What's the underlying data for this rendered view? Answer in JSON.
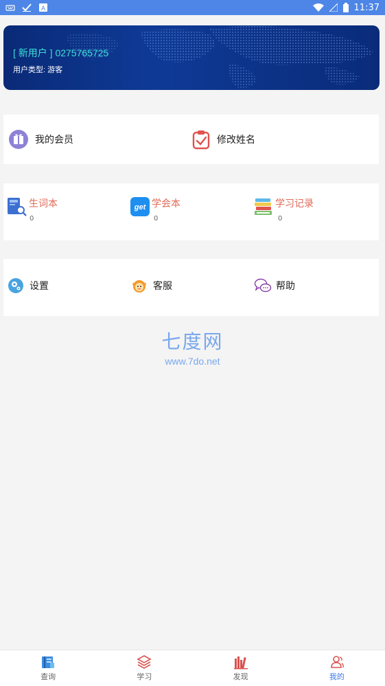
{
  "status_bar": {
    "time": "11:37"
  },
  "banner": {
    "user_id": "[ 新用户 ] 0275765725",
    "user_type": "用户类型:  游客"
  },
  "card1": {
    "member_label": "我的会员",
    "rename_label": "修改姓名"
  },
  "card2": {
    "items": [
      {
        "label": "生词本",
        "count": "0"
      },
      {
        "label": "学会本",
        "count": "0"
      },
      {
        "label": "学习记录",
        "count": "0"
      }
    ]
  },
  "card3": {
    "settings_label": "设置",
    "service_label": "客服",
    "help_label": "帮助"
  },
  "watermark": {
    "title": "七度网",
    "url": "www.7do.net"
  },
  "tabs": [
    {
      "label": "查询"
    },
    {
      "label": "学习"
    },
    {
      "label": "发现"
    },
    {
      "label": "我的"
    }
  ],
  "colors": {
    "status_bar": "#4d86e6",
    "accent_blue": "#3a78e6",
    "accent_red": "#e06a57",
    "user_id_cyan": "#3ee0d7"
  }
}
